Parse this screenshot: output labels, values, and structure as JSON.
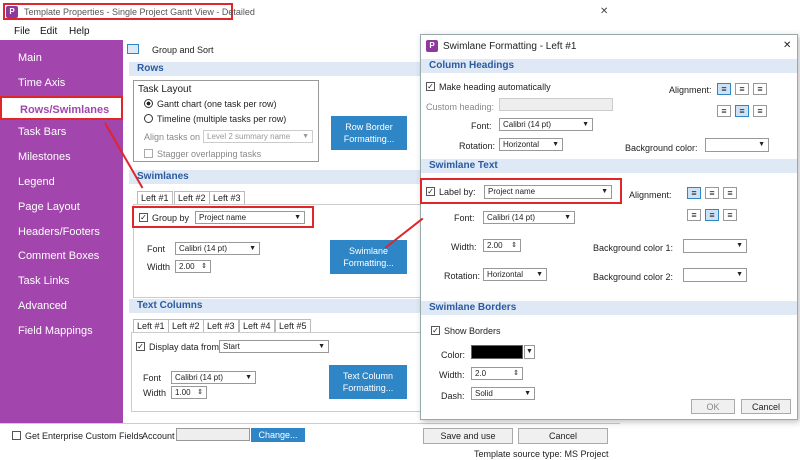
{
  "window": {
    "title": "Template Properties - Single Project Gantt View - Detailed",
    "close": "✕"
  },
  "menu": [
    "File",
    "Edit",
    "Help"
  ],
  "sidebar": {
    "items": [
      "Main",
      "Time Axis",
      "Rows/Swimlanes",
      "Task Bars",
      "Milestones",
      "Legend",
      "Page Layout",
      "Headers/Footers",
      "Comment Boxes",
      "Task Links",
      "Advanced",
      "Field Mappings"
    ],
    "selected": 2
  },
  "main": {
    "group_sort": "Group and Sort",
    "rows": {
      "header": "Rows",
      "task_layout": "Task Layout",
      "opt_gantt": "Gantt chart (one task per row)",
      "opt_timeline": "Timeline (multiple tasks per row)",
      "align_tasks_on": "Align tasks on",
      "align_value": "Level 2 summary name",
      "stagger": "Stagger overlapping tasks",
      "row_border_btn": "Row Border Formatting..."
    },
    "swimlanes": {
      "header": "Swimlanes",
      "tabs": [
        "Left #1",
        "Left #2",
        "Left #3"
      ],
      "group_by": "Group by",
      "group_value": "Project name",
      "font_label": "Font",
      "font_value": "Calibri (14 pt)",
      "width_label": "Width",
      "width_value": "2.00",
      "formatting_btn": "Swimlane Formatting..."
    },
    "text_columns": {
      "header": "Text Columns",
      "tabs": [
        "Left #1",
        "Left #2",
        "Left #3",
        "Left #4",
        "Left #5"
      ],
      "display_from": "Display data from",
      "display_value": "Start",
      "font_label": "Font",
      "font_value": "Calibri (14 pt)",
      "width_label": "Width",
      "width_value": "1.00",
      "formatting_btn": "Text Column Formatting..."
    }
  },
  "footer": {
    "enterprise": "Get Enterprise Custom Fields",
    "account": "Account",
    "change": "Change...",
    "save": "Save and use",
    "cancel": "Cancel",
    "source": "Template source type: MS Project"
  },
  "dialog": {
    "title": "Swimlane Formatting - Left #1",
    "close": "✕",
    "col_head": {
      "header": "Column Headings",
      "auto": "Make heading automatically",
      "custom": "Custom heading:",
      "font_label": "Font:",
      "font_value": "Calibri (14 pt)",
      "rot_label": "Rotation:",
      "rot_value": "Horizontal",
      "align_label": "Alignment:",
      "bg_label": "Background color:"
    },
    "swim_text": {
      "header": "Swimlane Text",
      "label_by": "Label by:",
      "label_value": "Project name",
      "font_label": "Font:",
      "font_value": "Calibri (14 pt)",
      "width_label": "Width:",
      "width_value": "2.00",
      "rot_label": "Rotation:",
      "rot_value": "Horizontal",
      "align_label": "Alignment:",
      "bg1": "Background color 1:",
      "bg2": "Background color 2:"
    },
    "borders": {
      "header": "Swimlane Borders",
      "show": "Show Borders",
      "color_label": "Color:",
      "width_label": "Width:",
      "width_value": "2.0",
      "dash_label": "Dash:",
      "dash_value": "Solid"
    },
    "ok": "OK",
    "cancel": "Cancel"
  },
  "colors": {
    "sidebar": "#a245ac",
    "accent": "#2f86c7",
    "highlight": "#e0252b"
  }
}
